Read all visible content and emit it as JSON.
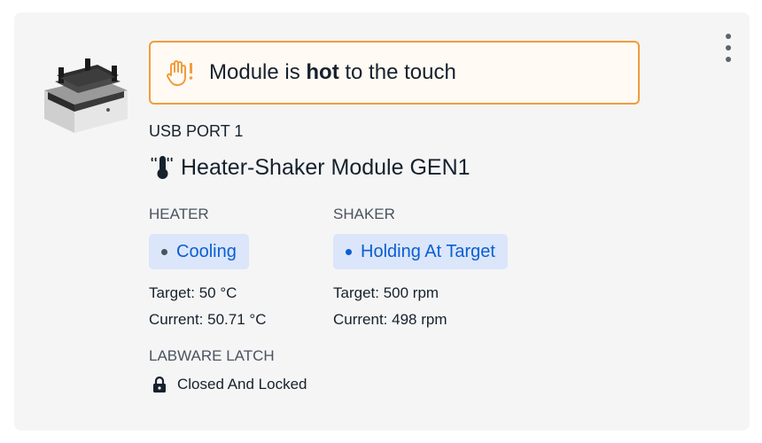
{
  "module_image": "heater-shaker-module-image",
  "menu": {
    "icon": "overflow-menu-icon"
  },
  "banner": {
    "icon": "hot-hand-warning-icon",
    "text_prefix": "Module is ",
    "text_bold": "hot",
    "text_suffix": " to the touch",
    "border_color": "#f09d3d"
  },
  "port": {
    "label": "USB PORT 1"
  },
  "module": {
    "icon": "thermometer-icon",
    "name": "Heater-Shaker Module GEN1"
  },
  "heater": {
    "title": "HEATER",
    "status": "Cooling",
    "status_dot_color": "#4a5360",
    "target": "Target: 50 °C",
    "current": "Current: 50.71 °C"
  },
  "shaker": {
    "title": "SHAKER",
    "status": "Holding At Target",
    "status_dot_color": "#0a5fd1",
    "target": "Target: 500 rpm",
    "current": "Current: 498 rpm"
  },
  "latch": {
    "title": "LABWARE LATCH",
    "icon": "lock-icon",
    "status": "Closed And Locked"
  },
  "colors": {
    "card_bg": "#f5f5f5",
    "pill_bg": "#dbe6fb",
    "pill_text": "#0a5fd1",
    "banner_bg": "#fffaf3"
  }
}
